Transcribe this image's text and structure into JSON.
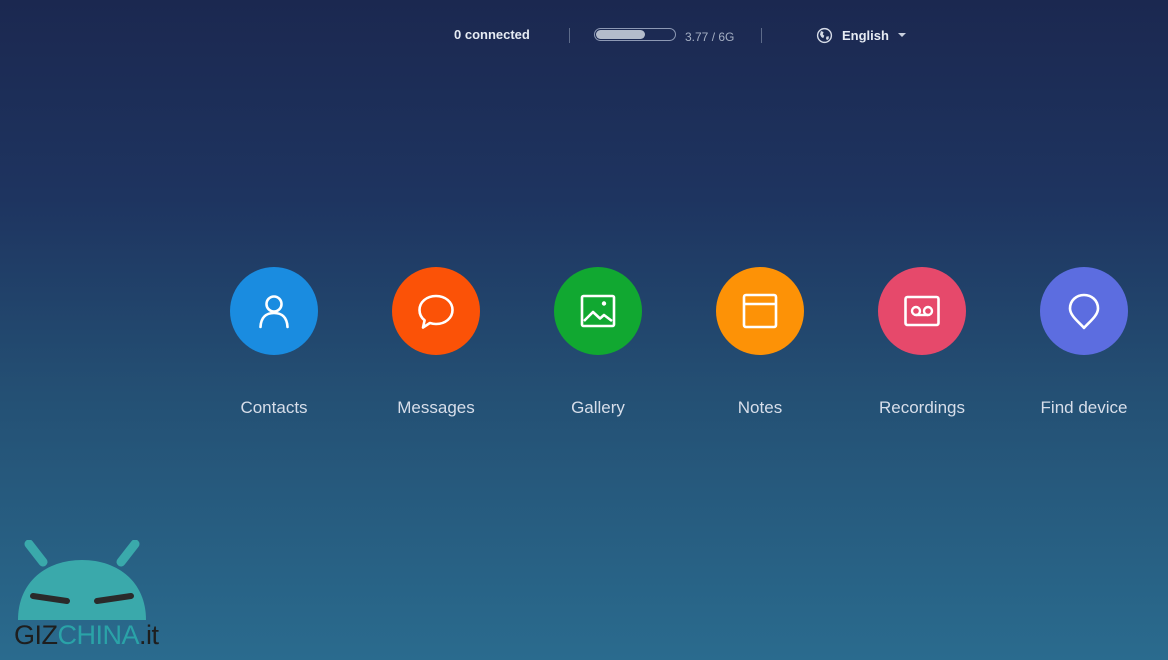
{
  "status_bar": {
    "connected_text": "0 connected",
    "storage": {
      "used_fraction": 0.63,
      "text": "3.77 / 6G"
    },
    "language": {
      "icon": "globe-icon",
      "label": "English"
    }
  },
  "apps": [
    {
      "label": "Contacts",
      "icon": "contact-icon",
      "color": "#1a8ce0"
    },
    {
      "label": "Messages",
      "icon": "message-icon",
      "color": "#fb5207"
    },
    {
      "label": "Gallery",
      "icon": "image-icon",
      "color": "#11a831"
    },
    {
      "label": "Notes",
      "icon": "note-icon",
      "color": "#fd9206"
    },
    {
      "label": "Recordings",
      "icon": "recording-icon",
      "color": "#e6496b"
    },
    {
      "label": "Find device",
      "icon": "location-icon",
      "color": "#5c6de0"
    }
  ],
  "watermark": {
    "part1": "GIZ",
    "part2": "CHINA",
    "part3": ".it",
    "brand_color": "#2aa3a8"
  }
}
